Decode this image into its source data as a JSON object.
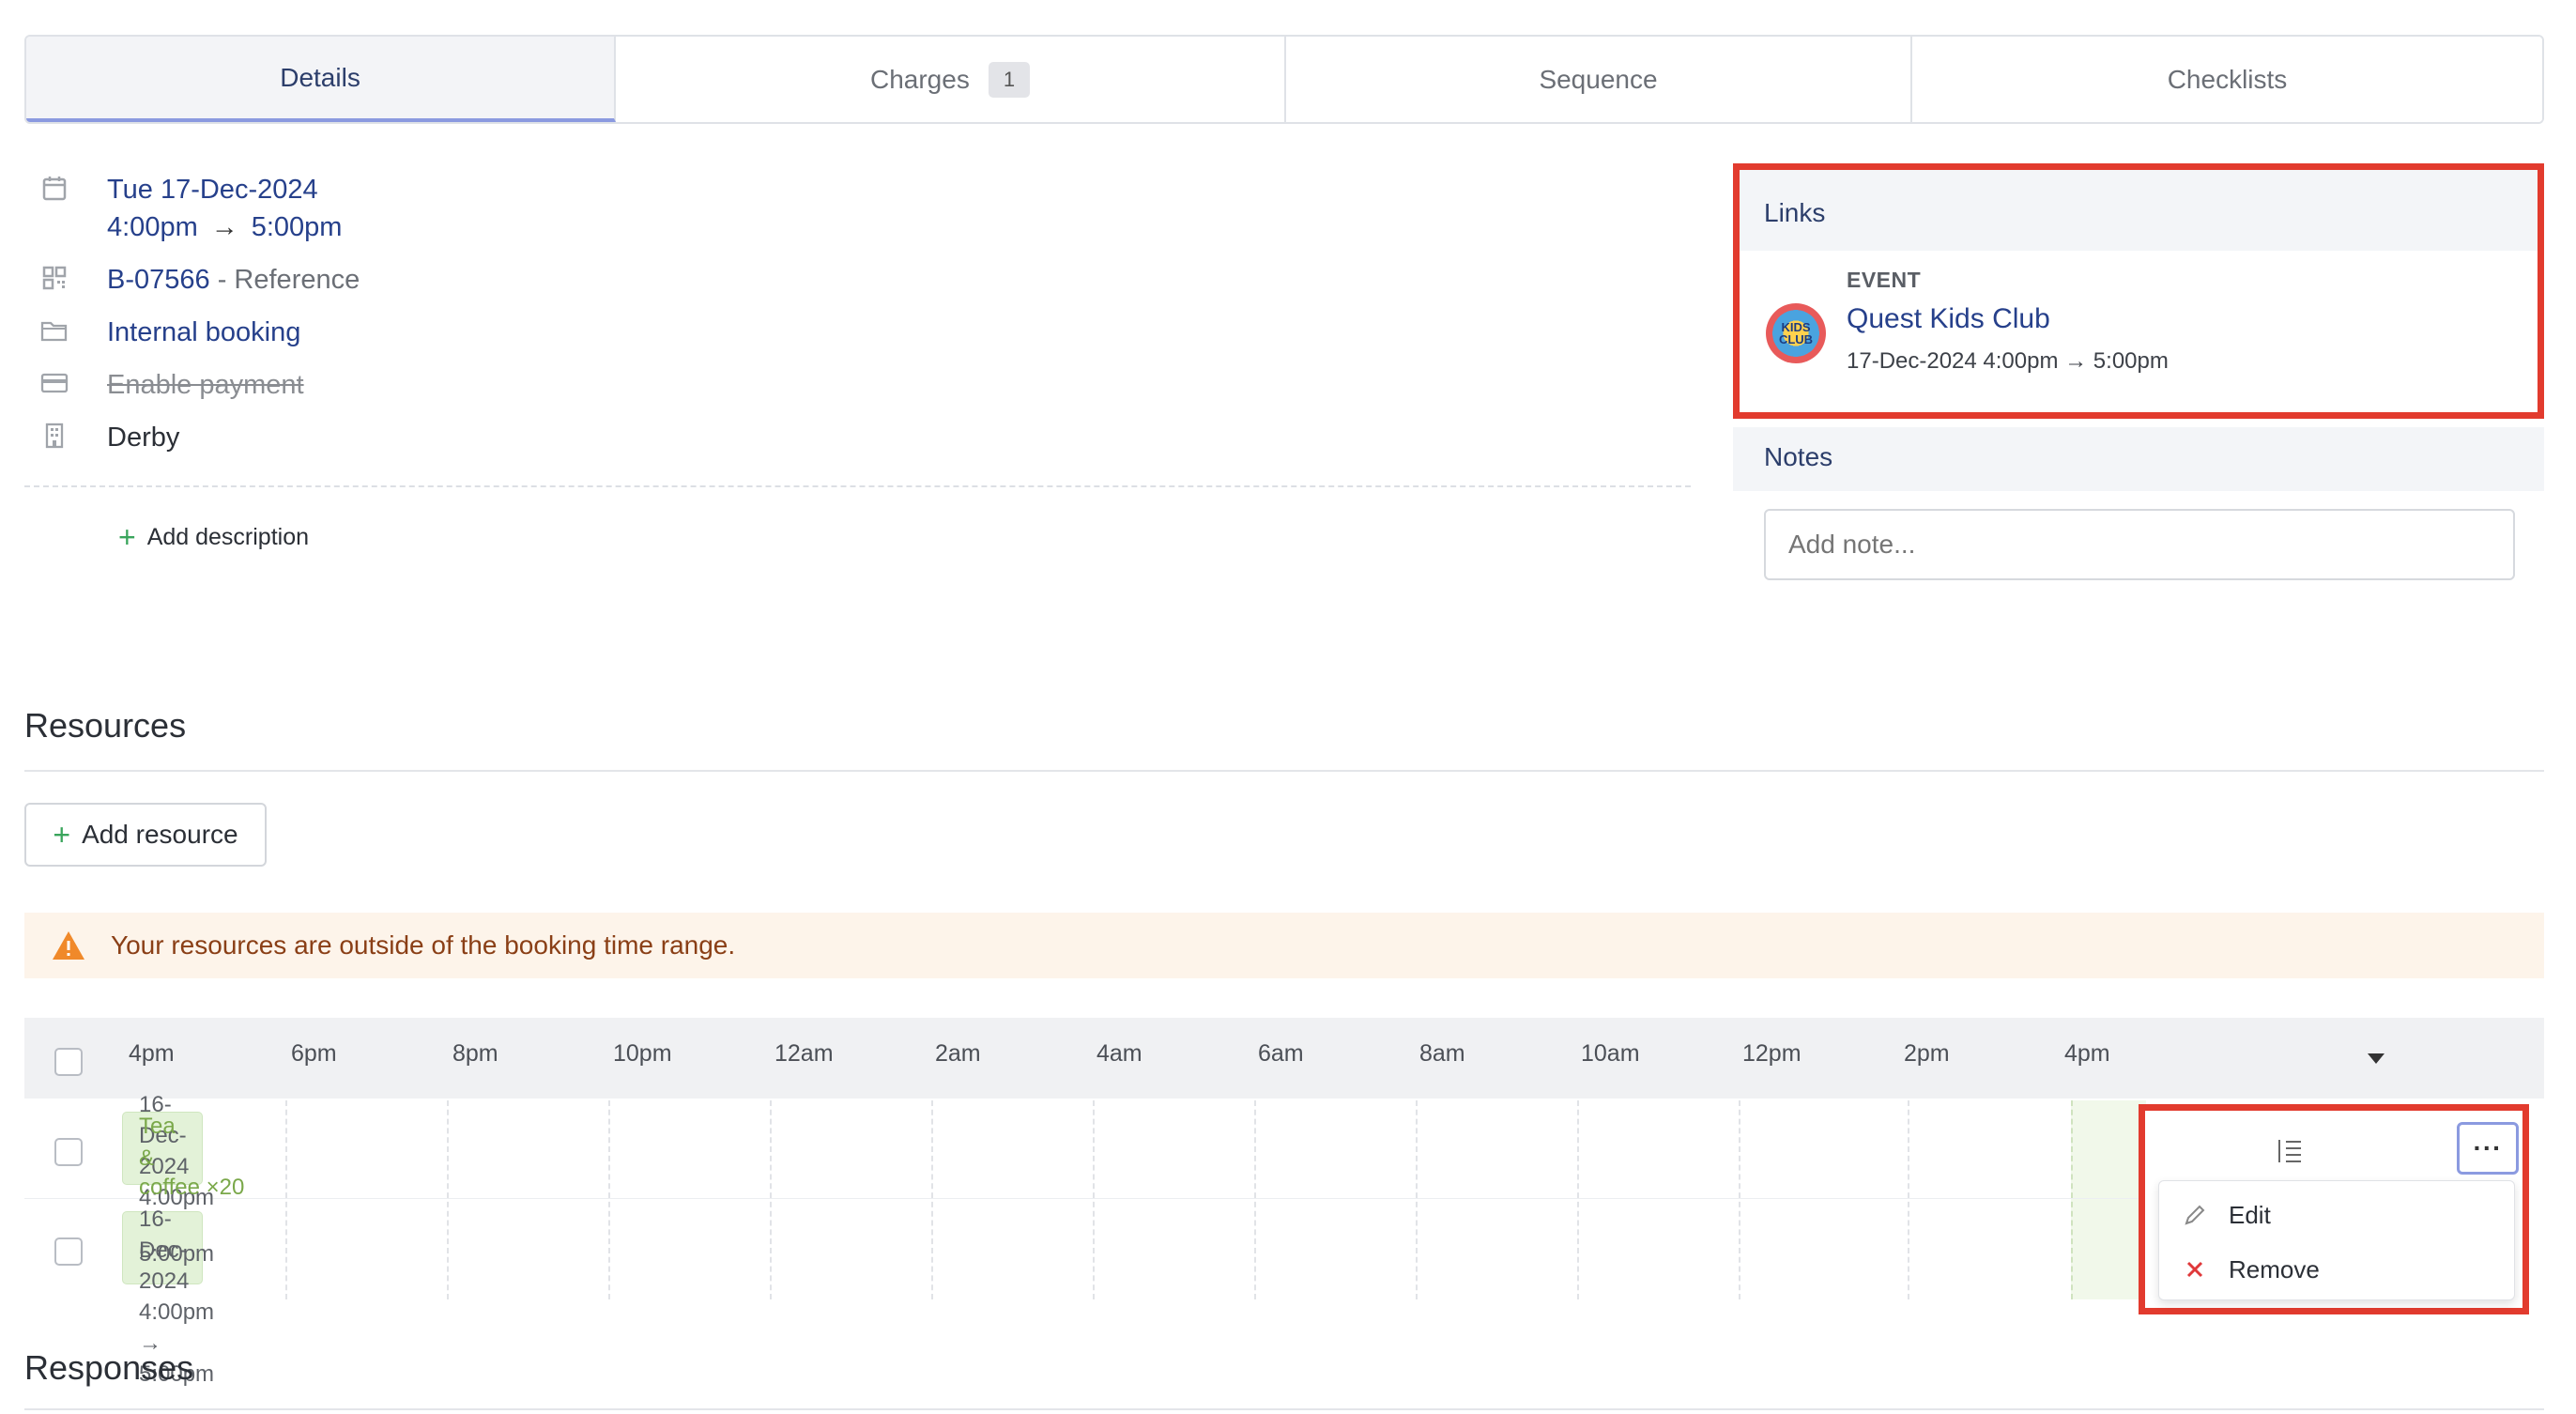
{
  "tabs": [
    {
      "label": "Details",
      "badge": ""
    },
    {
      "label": "Charges",
      "badge": "1"
    },
    {
      "label": "Sequence",
      "badge": ""
    },
    {
      "label": "Checklists",
      "badge": ""
    }
  ],
  "details": {
    "date": "Tue 17-Dec-2024",
    "time_start": "4:00pm",
    "time_end": "5:00pm",
    "reference_id": "B-07566",
    "reference_label": "- Reference",
    "booking_type": "Internal booking",
    "payment": "Enable payment",
    "location": "Derby",
    "add_description": "Add description"
  },
  "links": {
    "title": "Links",
    "event_label": "EVENT",
    "event_title": "Quest Kids Club",
    "event_time": "17-Dec-2024 4:00pm → 5:00pm",
    "logo_text": "KIDS CLUB"
  },
  "notes": {
    "title": "Notes",
    "placeholder": "Add note..."
  },
  "resources": {
    "title": "Resources",
    "add_button": "Add resource",
    "warning": "Your resources are outside of the booking time range.",
    "hours": [
      "4pm",
      "6pm",
      "8pm",
      "10pm",
      "12am",
      "2am",
      "4am",
      "6am",
      "8am",
      "10am",
      "12pm",
      "2pm",
      "4pm"
    ],
    "row1_lines": [
      "16-",
      "Dec-",
      "2024",
      "4:00pm"
    ],
    "row1_overlay": [
      "Tea",
      "&"
    ],
    "row1_green": "coffee ×20",
    "row2_lines": [
      "16-",
      "Dec-",
      "2024",
      "4:00pm",
      "→",
      "5:00pm"
    ],
    "row2_overlay": "5:00pm",
    "menu": {
      "more": "···",
      "edit": "Edit",
      "remove": "Remove"
    }
  },
  "responses": {
    "title": "Responses"
  }
}
